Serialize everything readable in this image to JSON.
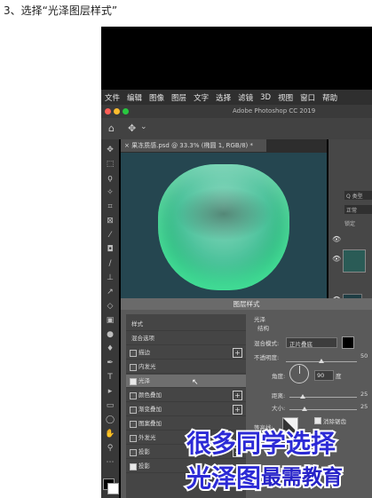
{
  "caption": "3、选择“光泽图层样式”",
  "menubar": {
    "items": [
      "文件",
      "编辑",
      "图像",
      "图层",
      "文字",
      "选择",
      "滤镜",
      "3D",
      "视图",
      "窗口",
      "帮助"
    ]
  },
  "window": {
    "title": "Adobe Photoshop CC 2019",
    "traffic_colors": [
      "#ff5f57",
      "#febc2e",
      "#28c840"
    ]
  },
  "options_bar": {
    "home_icon": "home-icon",
    "move_icon": "move-tool-icon",
    "dropdown": "⌄"
  },
  "document": {
    "tab_label": "× 果冻质感.psd @ 33.3% (椭圆 1, RGB/8) *",
    "canvas_color": "#254650",
    "shape_color": "#3dc18e"
  },
  "right_panel": {
    "search_label": "Q 类型",
    "mode_label": "正常",
    "lock_label": "锁定"
  },
  "dialog": {
    "title": "图层样式",
    "list": {
      "header": "样式",
      "blend_options": "混合选项",
      "items": [
        {
          "label": "描边",
          "checked": false,
          "plus": true
        },
        {
          "label": "内发光",
          "checked": false,
          "plus": false
        },
        {
          "label": "光泽",
          "checked": true,
          "plus": false,
          "selected": true
        },
        {
          "label": "颜色叠加",
          "checked": false,
          "plus": true
        },
        {
          "label": "渐变叠加",
          "checked": false,
          "plus": true
        },
        {
          "label": "图案叠加",
          "checked": false,
          "plus": false
        },
        {
          "label": "外发光",
          "checked": false,
          "plus": false
        },
        {
          "label": "投影",
          "checked": false,
          "plus": true
        },
        {
          "label": "投影",
          "checked": true,
          "plus": false
        }
      ]
    },
    "settings": {
      "section": "光泽",
      "subsection": "结构",
      "blend_mode_label": "混合模式:",
      "blend_mode_value": "正片叠底",
      "opacity_label": "不透明度:",
      "opacity_value": "50",
      "angle_label": "角度:",
      "angle_value": "90",
      "angle_unit": "度",
      "distance_label": "距离:",
      "distance_value": "25",
      "size_label": "大小:",
      "size_value": "25",
      "contour_label": "等高线:",
      "antialias_label": "消除锯齿",
      "antialias_checked": true
    }
  },
  "overlay": {
    "line1": "很多同学选择",
    "line2_part1": "光泽图",
    "watermark": "最需教育"
  }
}
